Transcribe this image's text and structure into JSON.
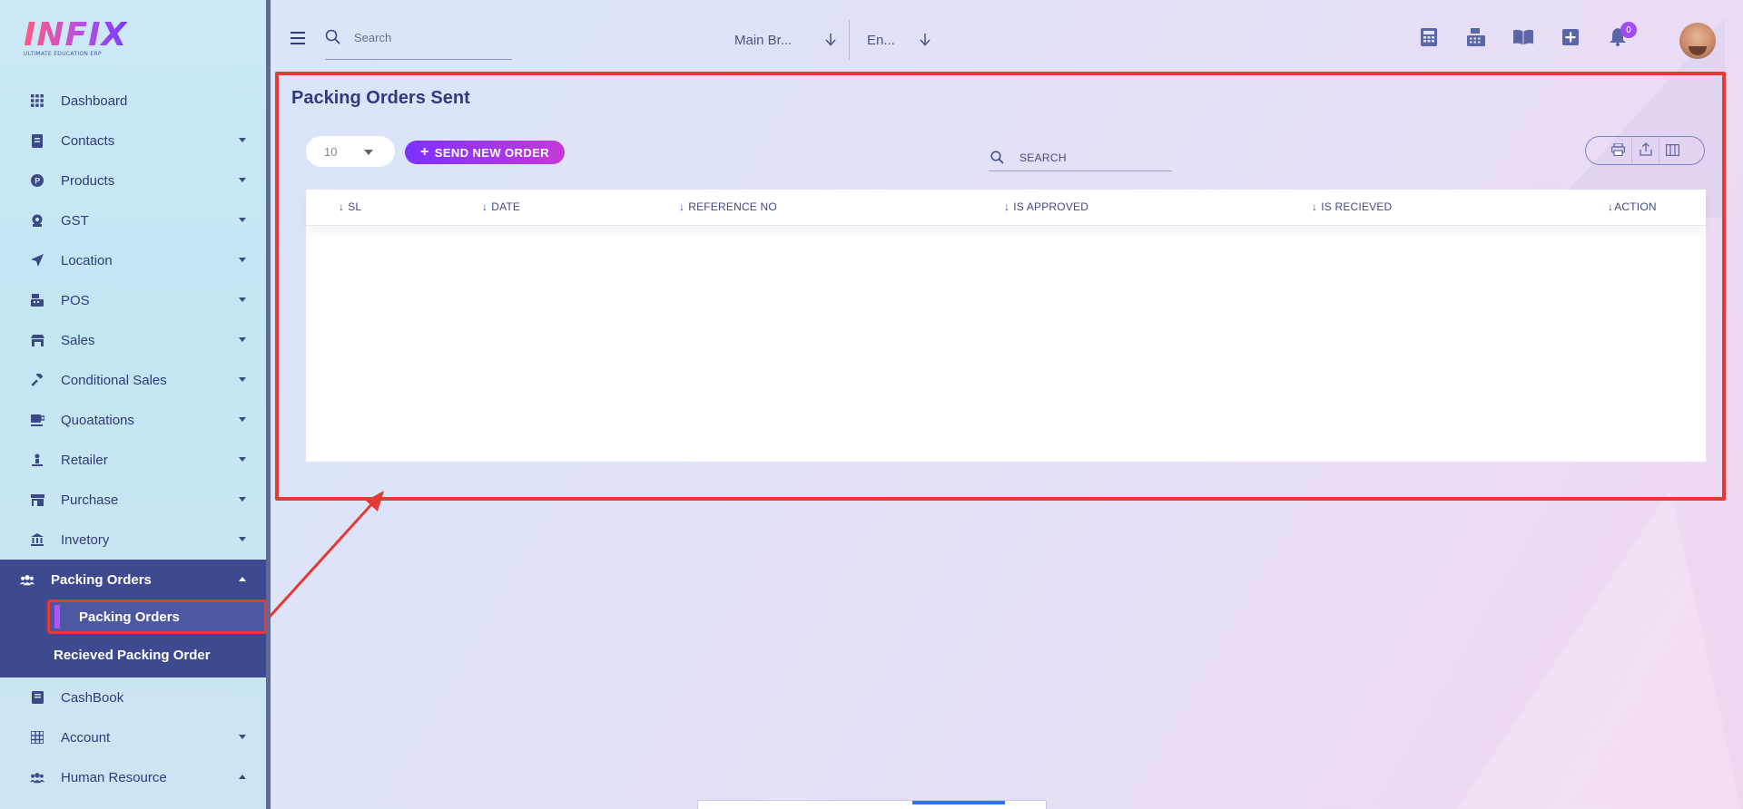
{
  "app": {
    "logo": "INFIX",
    "logo_subtitle": "ULTIMATE EDUCATION ERP"
  },
  "header": {
    "search_placeholder": "Search",
    "branch": "Main Br...",
    "language": "En...",
    "notification_count": "0",
    "icons": [
      "calculator-icon",
      "cash-register-icon",
      "book-icon",
      "plus-square-icon",
      "bell-icon"
    ]
  },
  "sidebar": {
    "items": [
      {
        "label": "Dashboard",
        "icon": "grid-icon",
        "caret": false
      },
      {
        "label": "Contacts",
        "icon": "contacts-icon",
        "caret": true
      },
      {
        "label": "Products",
        "icon": "products-icon",
        "caret": true
      },
      {
        "label": "GST",
        "icon": "gst-icon",
        "caret": true
      },
      {
        "label": "Location",
        "icon": "location-arrow-icon",
        "caret": true
      },
      {
        "label": "POS",
        "icon": "pos-icon",
        "caret": true
      },
      {
        "label": "Sales",
        "icon": "store-icon",
        "caret": true
      },
      {
        "label": "Conditional Sales",
        "icon": "gavel-icon",
        "caret": true
      },
      {
        "label": "Quoatations",
        "icon": "mug-icon",
        "caret": true
      },
      {
        "label": "Retailer",
        "icon": "retailer-icon",
        "caret": true
      },
      {
        "label": "Purchase",
        "icon": "shop-icon",
        "caret": true
      },
      {
        "label": "Invetory",
        "icon": "bank-icon",
        "caret": true
      }
    ],
    "active_section": {
      "label": "Packing Orders",
      "icon": "users-icon"
    },
    "sub_items": [
      "Packing Orders",
      "Recieved Packing Order"
    ],
    "after_items": [
      {
        "label": "CashBook",
        "icon": "cashbook-icon",
        "caret": false
      },
      {
        "label": "Account",
        "icon": "calculator-grid-icon",
        "caret": true
      },
      {
        "label": "Human Resource",
        "icon": "users-icon",
        "caret": true
      }
    ]
  },
  "main": {
    "title": "Packing Orders Sent",
    "page_size": "10",
    "send_button": "SEND NEW ORDER",
    "search_placeholder": "SEARCH",
    "columns": [
      "SL",
      "DATE",
      "REFERENCE NO",
      "IS APPROVED",
      "IS RECIEVED",
      "ACTION"
    ],
    "rows": []
  },
  "colors": {
    "accent": "#7c32ff",
    "accent_end": "#c738d8",
    "sidebar_active": "#3e4a8f",
    "highlight": "#e53935"
  }
}
